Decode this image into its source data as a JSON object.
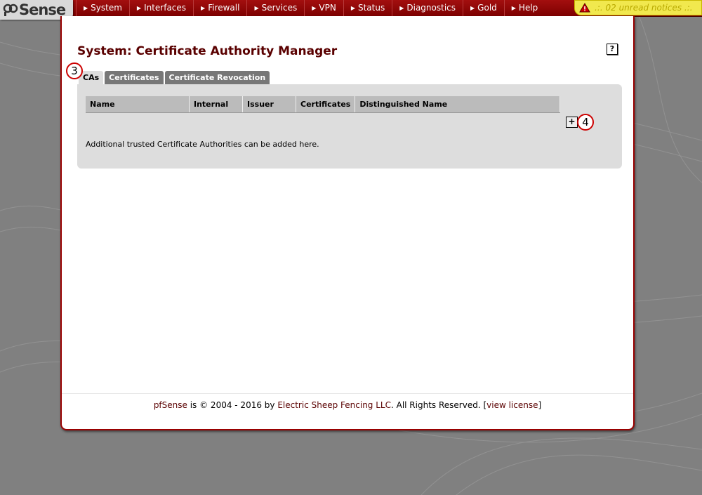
{
  "logo": {
    "text": "Sense"
  },
  "nav": {
    "items": [
      "System",
      "Interfaces",
      "Firewall",
      "Services",
      "VPN",
      "Status",
      "Diagnostics",
      "Gold",
      "Help"
    ]
  },
  "notice": {
    "text": ".:. 02 unread notices .:."
  },
  "page": {
    "title": "System: Certificate Authority Manager",
    "help_label": "?"
  },
  "tabs": [
    "CAs",
    "Certificates",
    "Certificate Revocation"
  ],
  "annotations": {
    "tab_marker": "3",
    "add_marker": "4"
  },
  "table": {
    "headers": [
      "Name",
      "Internal",
      "Issuer",
      "Certificates",
      "Distinguished Name"
    ]
  },
  "add_button": {
    "label": "+"
  },
  "info_text": "Additional trusted Certificate Authorities can be added here.",
  "footer": {
    "product": "pfSense",
    "middle": " is © 2004 - 2016 by ",
    "company": "Electric Sheep Fencing LLC",
    "rights": ". All Rights Reserved. [",
    "license": "view license",
    "close": "]"
  },
  "colors": {
    "brand_red": "#990000",
    "title_red": "#5a0000",
    "notice_yellow": "#f1e84e"
  }
}
